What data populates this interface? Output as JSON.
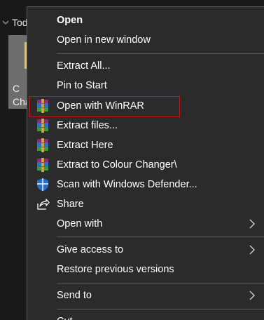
{
  "background": {
    "section_title": "Tod",
    "tile_text_1": "C",
    "tile_text_2": "Cha"
  },
  "menu": {
    "open": "Open",
    "open_new_window": "Open in new window",
    "extract_all": "Extract All...",
    "pin_to_start": "Pin to Start",
    "open_with_winrar": "Open with WinRAR",
    "extract_files": "Extract files...",
    "extract_here": "Extract Here",
    "extract_to": "Extract to Colour Changer\\",
    "scan_defender": "Scan with Windows Defender...",
    "share": "Share",
    "open_with": "Open with",
    "give_access_to": "Give access to",
    "restore_previous": "Restore previous versions",
    "send_to": "Send to",
    "cut": "Cut"
  },
  "colors": {
    "menu_bg": "#2b2b2b",
    "highlight_border": "#c0181f",
    "defender_blue": "#1f6fd1"
  },
  "icons": {
    "winrar": "winrar-icon",
    "defender": "windows-defender-icon",
    "share": "share-icon",
    "submenu": "chevron-right-icon"
  }
}
